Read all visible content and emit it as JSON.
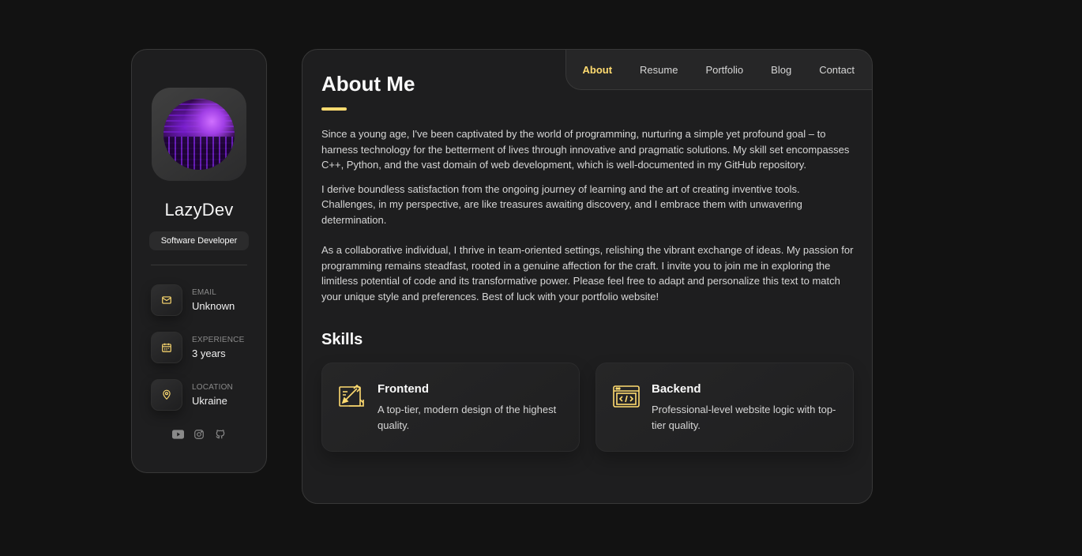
{
  "colors": {
    "accent": "#ffdb70",
    "background": "#121212",
    "card": "#1e1e1f"
  },
  "profile": {
    "name": "LazyDev",
    "role": "Software Developer",
    "avatar_icon": "avatar-image"
  },
  "contacts": [
    {
      "icon": "mail-icon",
      "label": "EMAIL",
      "value": "Unknown"
    },
    {
      "icon": "calendar-icon",
      "label": "EXPERIENCE",
      "value": "3 years"
    },
    {
      "icon": "location-icon",
      "label": "LOCATION",
      "value": "Ukraine"
    }
  ],
  "socials": [
    "youtube-icon",
    "instagram-icon",
    "github-icon"
  ],
  "nav": {
    "items": [
      "About",
      "Resume",
      "Portfolio",
      "Blog",
      "Contact"
    ],
    "active": "About"
  },
  "about": {
    "title": "About Me",
    "paragraphs": [
      "Since a young age, I've been captivated by the world of programming, nurturing a simple yet profound goal – to harness technology for the betterment of lives through innovative and pragmatic solutions. My skill set encompasses C++, Python, and the vast domain of web development, which is well-documented in my GitHub repository.",
      "I derive boundless satisfaction from the ongoing journey of learning and the art of creating inventive tools. Challenges, in my perspective, are like treasures awaiting discovery, and I embrace them with unwavering determination.",
      "As a collaborative individual, I thrive in team-oriented settings, relishing the vibrant exchange of ideas. My passion for programming remains steadfast, rooted in a genuine affection for the craft. I invite you to join me in exploring the limitless potential of code and its transformative power. Please feel free to adapt and personalize this text to match your unique style and preferences. Best of luck with your portfolio website!"
    ]
  },
  "skills": {
    "title": "Skills",
    "items": [
      {
        "icon": "design-icon",
        "name": "Frontend",
        "description": "A top-tier, modern design of the highest quality."
      },
      {
        "icon": "code-icon",
        "name": "Backend",
        "description": "Professional-level website logic with top-tier quality."
      }
    ]
  }
}
